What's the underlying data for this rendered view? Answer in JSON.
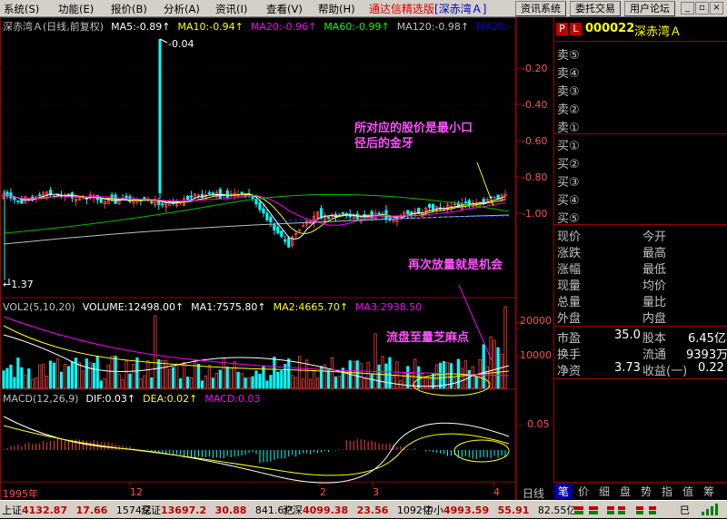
{
  "menu": [
    "系统(S)",
    "功能(E)",
    "报价(B)",
    "分析(A)",
    "资讯(I)",
    "查看(V)",
    "帮助(H)"
  ],
  "brand": "通达信精选版",
  "window_title": "[深赤湾Ａ]",
  "tool_buttons": [
    "资讯系统",
    "委托交易",
    "用户论坛"
  ],
  "window_controls": {
    "minimize": "_",
    "restore": "▫",
    "close": "×"
  },
  "price_header": {
    "name": "深赤湾Ａ(日线,前复权)",
    "items": [
      {
        "label": "MA5:-0.89",
        "color": "#ffffff"
      },
      {
        "label": "MA10:-0.94",
        "color": "#ffff00"
      },
      {
        "label": "MA20:-0.96",
        "color": "#ff00ff"
      },
      {
        "label": "MA60:-0.99",
        "color": "#00ff00"
      },
      {
        "label": "MA120:-0.98",
        "color": "#c0c0c0"
      },
      {
        "label": "MA20:-",
        "color": "#0000ff"
      }
    ]
  },
  "price_axis": [
    "-0.20",
    "-0.40",
    "-0.60",
    "-0.80",
    "-1.00"
  ],
  "high_label": "-0.04",
  "low_label": "←1.37",
  "vol_header": {
    "name": "VOL2(5,10,20)",
    "items": [
      {
        "label": "VOLUME:12498.00",
        "color": "#ffffff"
      },
      {
        "label": "MA1:7575.80",
        "color": "#ffffff"
      },
      {
        "label": "MA2:4665.70",
        "color": "#ffff00"
      },
      {
        "label": "MA3:2938.50",
        "color": "#ff00ff"
      }
    ]
  },
  "vol_axis": [
    "20000",
    "10000"
  ],
  "macd_header": {
    "name": "MACD(12,26,9)",
    "items": [
      {
        "label": "DIF:0.03",
        "color": "#ffffff"
      },
      {
        "label": "DEA:0.02",
        "color": "#ffff00"
      },
      {
        "label": "MACD:0.03",
        "color": "#ff00ff"
      }
    ]
  },
  "macd_axis": [
    "0.05"
  ],
  "date_axis": [
    "1995年",
    "12",
    "2",
    "3",
    "4"
  ],
  "period_label": "日线",
  "annotations": [
    "所对应的股价是最小口",
    "径后的金牙",
    "再次放量就是机会",
    "流盘至量芝麻点"
  ],
  "right_panel": {
    "code": "000022",
    "name": "深赤湾Ａ",
    "sell": [
      "卖⑤",
      "卖④",
      "卖③",
      "卖②",
      "卖①"
    ],
    "buy": [
      "买①",
      "买②",
      "买③",
      "买④",
      "买⑤"
    ],
    "quote": [
      [
        "现价",
        "今开"
      ],
      [
        "涨跌",
        "最高"
      ],
      [
        "涨幅",
        "最低"
      ],
      [
        "现量",
        "均价"
      ],
      [
        "总量",
        "量比"
      ],
      [
        "外盘",
        "内盘"
      ]
    ],
    "fund": [
      {
        "l": "市盈",
        "v": "35.0",
        "l2": "股本",
        "v2": "6.45亿"
      },
      {
        "l": "换手",
        "v": "",
        "l2": "流通",
        "v2": "9393万"
      },
      {
        "l": "净资",
        "v": "3.73",
        "l2": "收益(一)",
        "v2": "0.22"
      }
    ]
  },
  "right_tabs": [
    "笔",
    "价",
    "细",
    "盘",
    "势",
    "指",
    "值",
    "筹"
  ],
  "status": [
    {
      "name": "上证",
      "index": "4132.87",
      "chg": "17.66",
      "amt": "1574亿"
    },
    {
      "name": "深证",
      "index": "13697.2",
      "chg": "30.88",
      "amt": "841.6亿"
    },
    {
      "name": "沪深",
      "index": "4099.38",
      "chg": "23.56",
      "amt": "1092亿"
    },
    {
      "name": "中小",
      "index": "4993.59",
      "chg": "55.91",
      "amt": "82.55亿"
    }
  ],
  "status_right": "巳"
}
